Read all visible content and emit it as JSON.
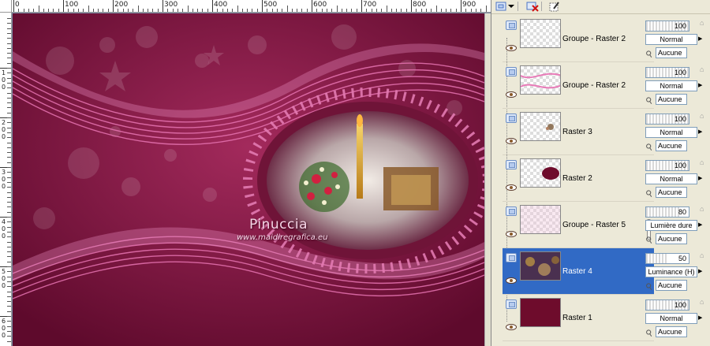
{
  "rulers": {
    "top_labels": [
      "0",
      "100",
      "200",
      "300",
      "400",
      "500",
      "600",
      "700",
      "800",
      "900"
    ],
    "left_labels": [
      "1\n0\n0",
      "2\n0\n0",
      "3\n0\n0",
      "4\n0\n0",
      "5\n0\n0",
      "6\n0\n0"
    ]
  },
  "canvas": {
    "watermark_name": "Pinuccia",
    "watermark_url": "www.maidiregrafica.eu",
    "background_color": "#7d1640"
  },
  "toolbar": {
    "icons": [
      "layer-view-icon",
      "dropdown-arrow-icon",
      "delete-layer-icon",
      "edit-icon"
    ]
  },
  "layers": [
    {
      "name": "Groupe - Raster 2",
      "opacity": "100",
      "opacity_level": 1.0,
      "blend": "Normal",
      "link": "Aucune",
      "thumb": "empty"
    },
    {
      "name": "Groupe - Raster 2",
      "opacity": "100",
      "opacity_level": 1.0,
      "blend": "Normal",
      "link": "Aucune",
      "thumb": "wave"
    },
    {
      "name": "Raster 3",
      "opacity": "100",
      "opacity_level": 1.0,
      "blend": "Normal",
      "link": "Aucune",
      "thumb": "speck"
    },
    {
      "name": "Raster 2",
      "opacity": "100",
      "opacity_level": 1.0,
      "blend": "Normal",
      "link": "Aucune",
      "thumb": "oval"
    },
    {
      "name": "Groupe - Raster 5",
      "opacity": "80",
      "opacity_level": 0.8,
      "blend": "Lumière dure",
      "link": "Aucune",
      "thumb": "faint"
    },
    {
      "name": "Raster 4",
      "opacity": "50",
      "opacity_level": 0.5,
      "blend": "Luminance (H)",
      "link": "Aucune",
      "thumb": "photo",
      "selected": true
    },
    {
      "name": "Raster 1",
      "opacity": "100",
      "opacity_level": 1.0,
      "blend": "Normal",
      "link": "Aucune",
      "thumb": "solid"
    }
  ],
  "colors": {
    "selection": "#316ac5",
    "panel_bg": "#ece9d8",
    "raster1_fill": "#6e0c2c"
  }
}
